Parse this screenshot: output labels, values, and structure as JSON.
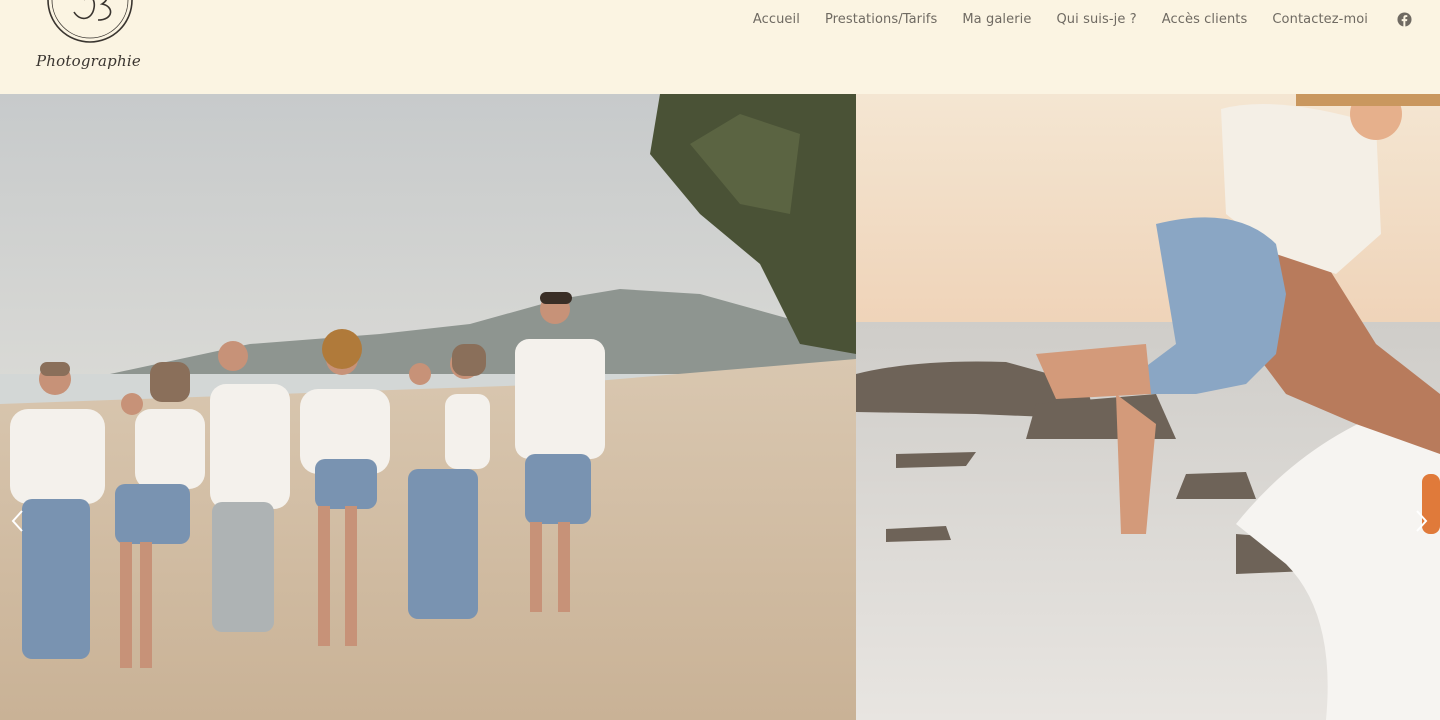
{
  "site": {
    "logo_text": "Photographie",
    "logo_monogram": "JB"
  },
  "nav": {
    "items": [
      {
        "label": "Accueil"
      },
      {
        "label": "Prestations/Tarifs"
      },
      {
        "label": "Ma galerie"
      },
      {
        "label": "Qui suis-je ?"
      },
      {
        "label": "Accès clients"
      },
      {
        "label": "Contactez-moi"
      }
    ],
    "social_icon": "facebook-icon"
  },
  "slider": {
    "slides": [
      {
        "subject": "family-walking-on-beach-photo"
      },
      {
        "subject": "father-lifting-baby-at-sea-photo"
      }
    ],
    "prev_icon": "chevron-left-icon",
    "next_icon": "chevron-right-icon"
  },
  "colors": {
    "header_bg": "#fbf4e2",
    "nav_text": "#6f6a62"
  }
}
